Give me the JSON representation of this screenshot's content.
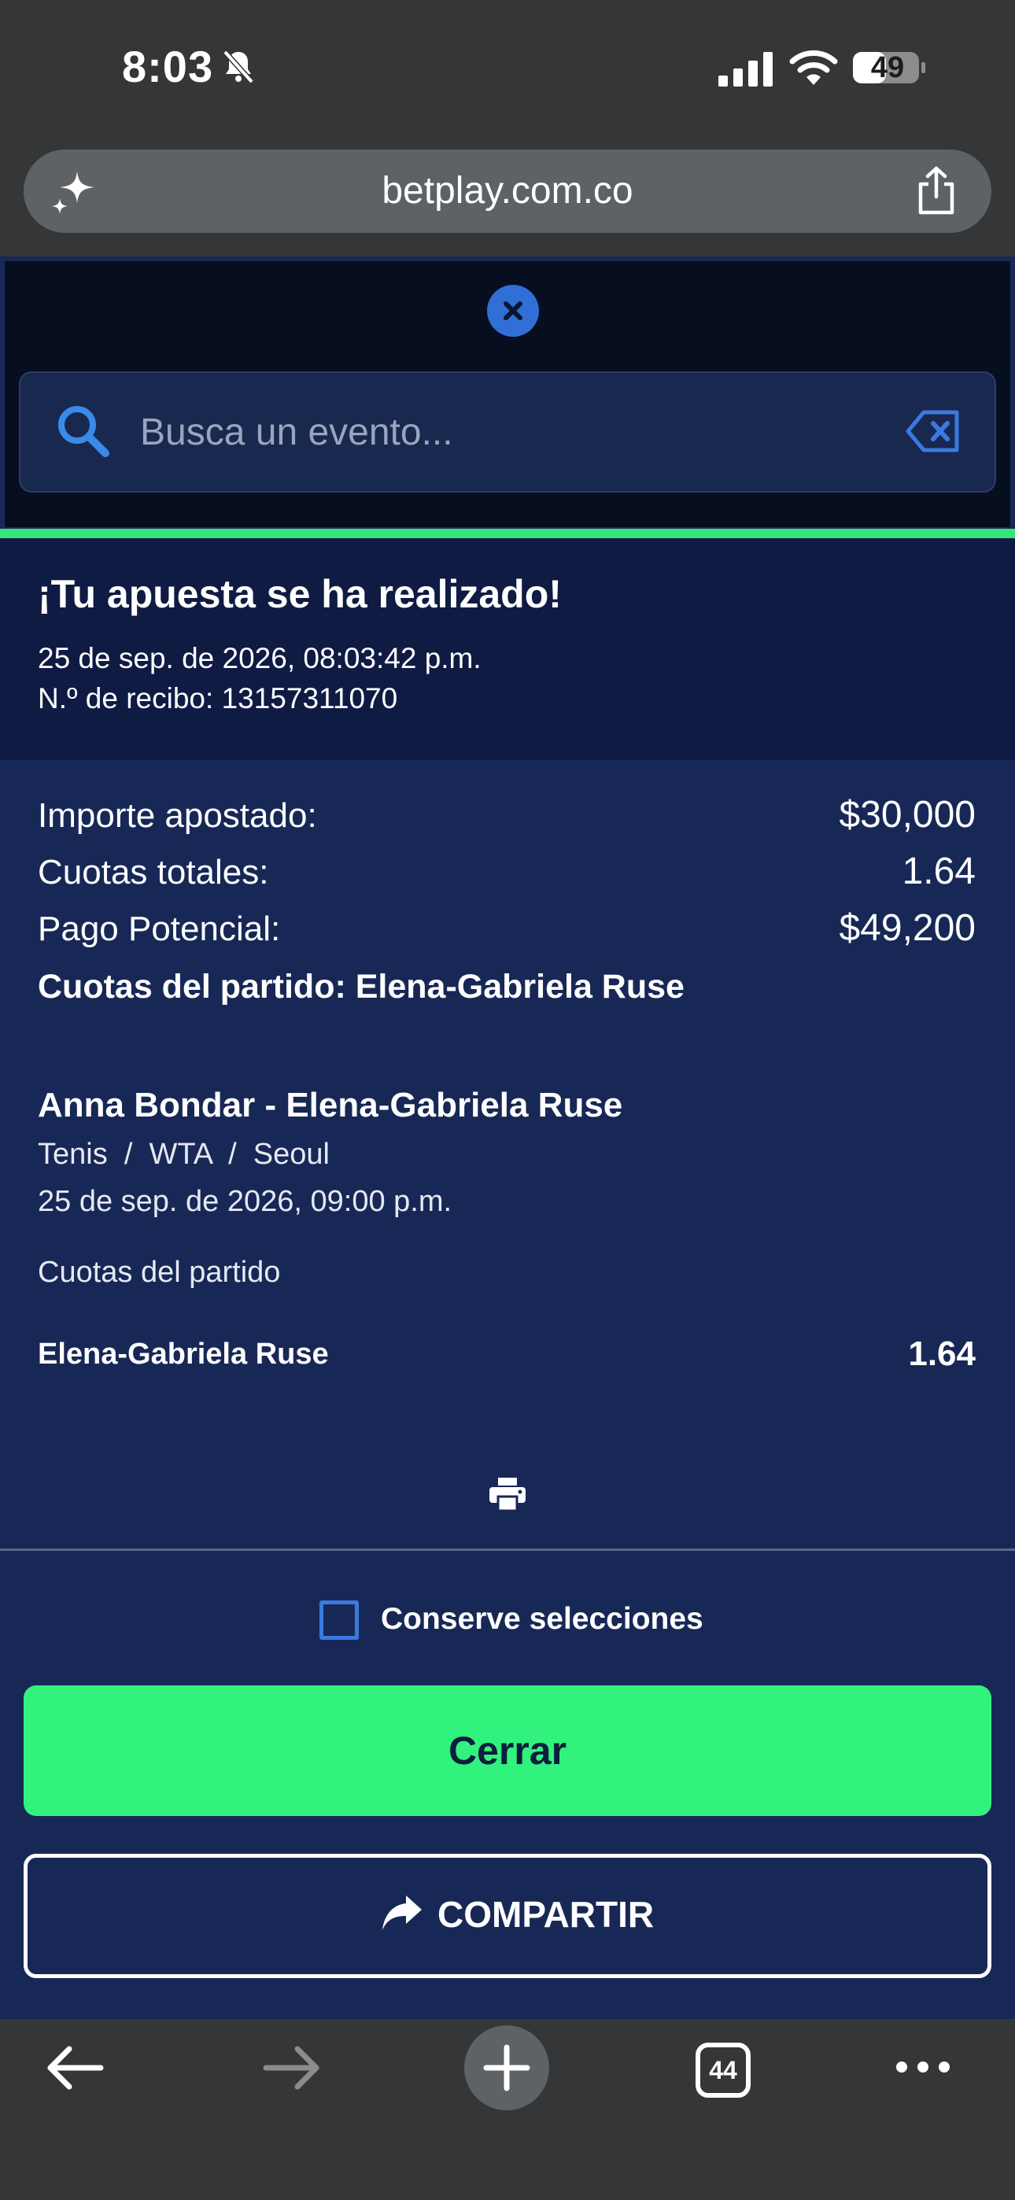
{
  "status_bar": {
    "time": "8:03",
    "battery": "49"
  },
  "browser": {
    "url": "betplay.com.co",
    "tab_count": "44"
  },
  "search": {
    "placeholder": "Busca un evento..."
  },
  "confirmation": {
    "title": "¡Tu apuesta se ha realizado!",
    "date": "25 de sep. de 2026, 08:03:42 p.m.",
    "receipt": "N.º de recibo: 13157311070"
  },
  "summary": {
    "stake_label": "Importe apostado:",
    "stake_value": "$30,000",
    "odds_label": "Cuotas totales:",
    "odds_value": "1.64",
    "payout_label": "Pago Potencial:",
    "payout_value": "$49,200",
    "match_odds_title": "Cuotas del partido: Elena-Gabriela Ruse"
  },
  "event": {
    "title": "Anna Bondar - Elena-Gabriela Ruse",
    "path": "Tenis  /  WTA  /  Seoul",
    "date": "25 de sep. de 2026, 09:00 p.m.",
    "market": "Cuotas del partido",
    "selection": "Elena-Gabriela Ruse",
    "selection_odds": "1.64"
  },
  "actions": {
    "keep_selections": "Conserve selecciones",
    "close": "Cerrar",
    "share": "COMPARTIR"
  },
  "colors": {
    "page_bg": "#182856",
    "header_bg": "#0f1b43",
    "accent_green": "#32f27e",
    "accent_blue": "#2f6fd6"
  },
  "icons": [
    "bell-slash-icon",
    "signal-icon",
    "wifi-icon",
    "battery-icon",
    "sparkle-icon",
    "share-icon",
    "close-icon",
    "search-icon",
    "clear-icon",
    "print-icon",
    "share-arrow-icon",
    "back-icon",
    "forward-icon",
    "plus-icon",
    "more-icon"
  ]
}
